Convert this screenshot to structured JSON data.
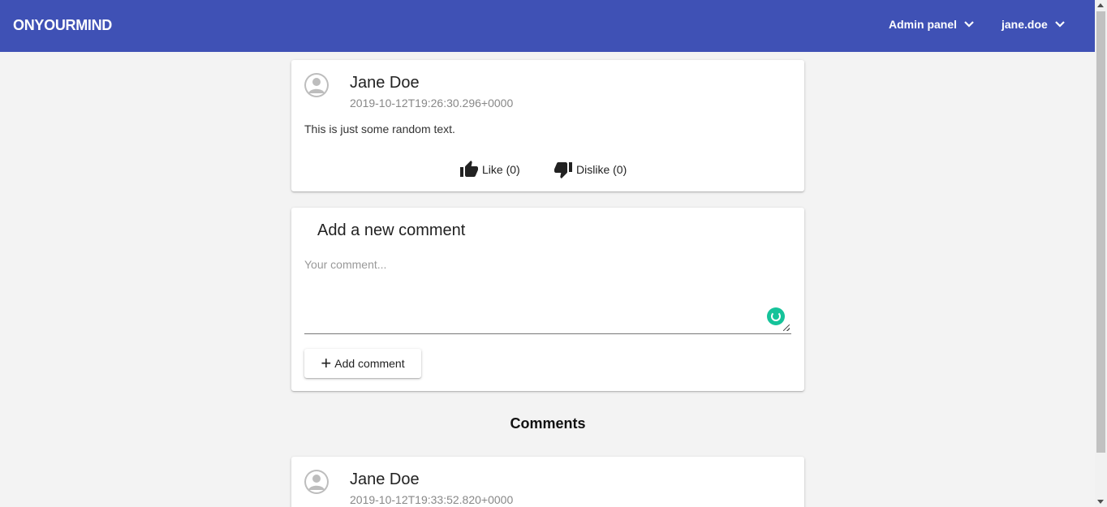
{
  "header": {
    "brand_light": "ON",
    "brand_bold": "YOURMIND",
    "admin_menu": "Admin panel",
    "user_menu": "jane.doe"
  },
  "post": {
    "author": "Jane Doe",
    "timestamp": "2019-10-12T19:26:30.296+0000",
    "text": "This is just some random text.",
    "like_label": "Like (0)",
    "dislike_label": "Dislike (0)"
  },
  "new_comment": {
    "title": "Add a new comment",
    "placeholder": "Your comment...",
    "button_label": "Add comment"
  },
  "comments": {
    "heading": "Comments",
    "items": [
      {
        "author": "Jane Doe",
        "timestamp": "2019-10-12T19:33:52.820+0000"
      }
    ]
  },
  "colors": {
    "appbar": "#3f51b5",
    "background": "#f3f3f3",
    "grammarly": "#15c39a"
  },
  "icons": {
    "like": "thumb-up-icon",
    "dislike": "thumb-down-icon",
    "add": "plus-icon",
    "menu": "chevron-down-icon"
  }
}
